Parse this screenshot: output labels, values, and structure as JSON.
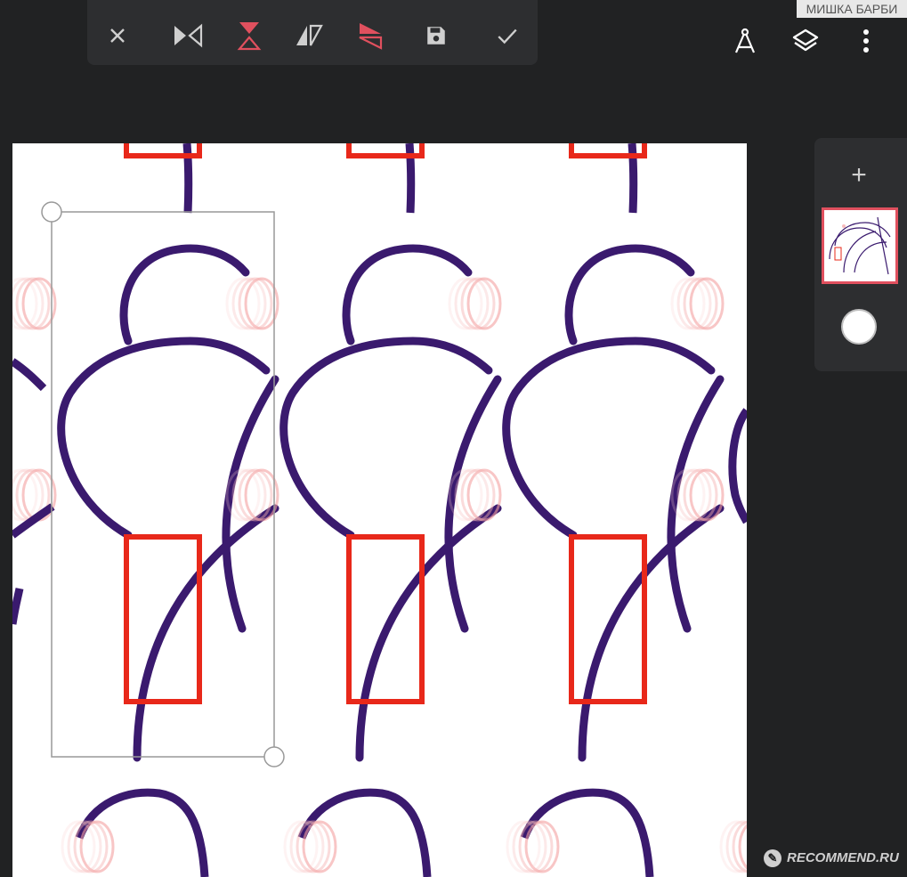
{
  "toolbar": {
    "buttons": [
      {
        "name": "close-button",
        "icon": "close-icon"
      },
      {
        "name": "mirror-horizontal-button",
        "icon": "mirror-horizontal-icon"
      },
      {
        "name": "mirror-vertical-button",
        "icon": "mirror-vertical-icon",
        "active": true
      },
      {
        "name": "skew-horizontal-button",
        "icon": "skew-horizontal-icon"
      },
      {
        "name": "skew-vertical-button",
        "icon": "skew-vertical-icon",
        "active": true
      },
      {
        "name": "save-button",
        "icon": "save-icon"
      },
      {
        "name": "confirm-button",
        "icon": "check-icon"
      }
    ]
  },
  "top_right": {
    "icons": [
      "ruler-compass-icon",
      "layers-icon",
      "more-vert-icon"
    ]
  },
  "watermark_top": "МИШКА БАРБИ",
  "watermark_bottom": "RECOMMEND.RU",
  "layer_panel": {
    "add_label": "+",
    "icons": [
      "add-layer-icon",
      "layer-thumbnail",
      "brush-color-swatch"
    ]
  },
  "colors": {
    "background": "#212223",
    "toolbar": "#2d2e30",
    "accent": "#e0505e",
    "stroke_purple": "#3a1a6e",
    "stroke_red": "#e8281a",
    "canvas": "#ffffff"
  }
}
